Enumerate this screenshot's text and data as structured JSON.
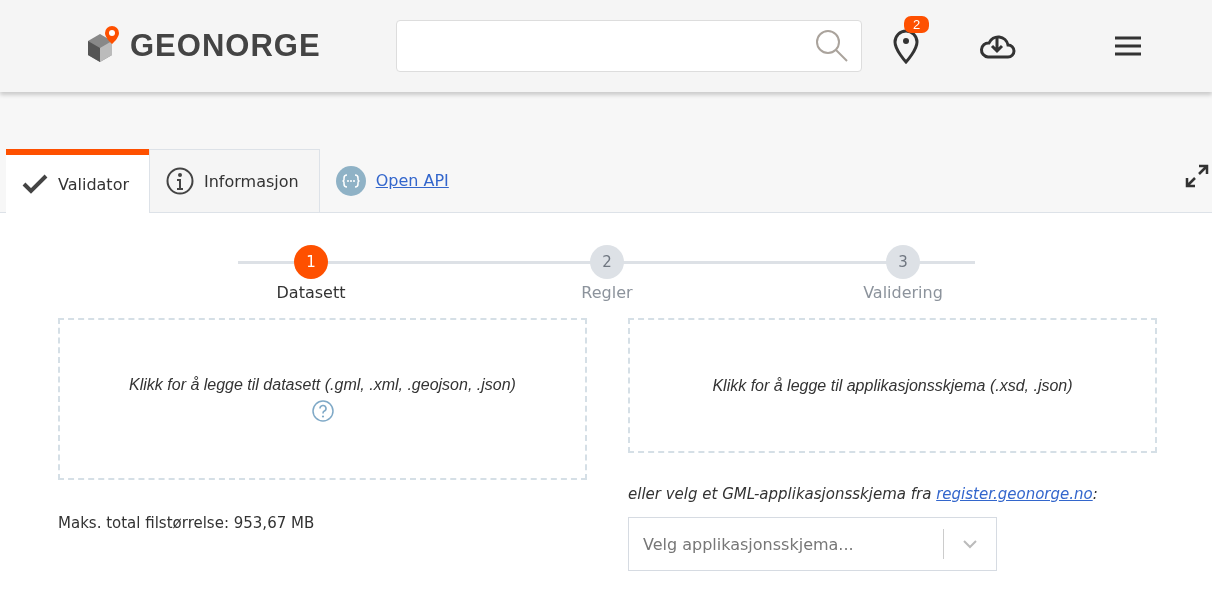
{
  "header": {
    "logo_text": "GEONORGE",
    "notification_count": "2"
  },
  "tabs": [
    {
      "label": "Validator",
      "kind": "check",
      "selected": true
    },
    {
      "label": "Informasjon",
      "kind": "info",
      "selected": false
    },
    {
      "label": "Open API",
      "kind": "link",
      "selected": false
    }
  ],
  "steps": [
    {
      "number": "1",
      "label": "Datasett",
      "selected": true
    },
    {
      "number": "2",
      "label": "Regler",
      "selected": false
    },
    {
      "number": "3",
      "label": "Validering",
      "selected": false
    }
  ],
  "dataset_drop": {
    "text": "Klikk for å legge til datasett (.gml, .xml, .geojson, .json)"
  },
  "max_size": "Maks. total filstørrelse: 953,67 MB",
  "schema_drop": {
    "text": "Klikk for å legge til applikasjonsskjema (.xsd, .json)"
  },
  "schema_hint": {
    "prefix": "eller velg et GML-applikasjonsskjema fra ",
    "link": "register.geonorge.no",
    "suffix": ":"
  },
  "schema_select": {
    "placeholder": "Velg applikasjonsskjema..."
  }
}
